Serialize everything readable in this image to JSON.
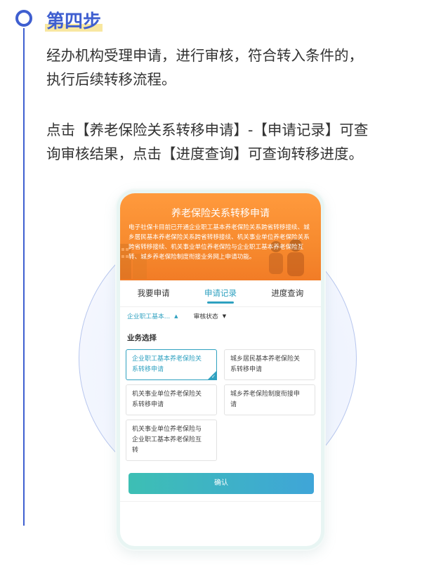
{
  "step": {
    "title": "第四步",
    "paragraph1_line1": "经办机构受理申请，进行审核，符合转入条件的，",
    "paragraph1_line2": "执行后续转移流程。",
    "paragraph2_line1": "点击【养老保险关系转移申请】-【申请记录】可查",
    "paragraph2_line2": "询审核结果，点击【进度查询】可查询转移进度。"
  },
  "phone": {
    "banner_title": "养老保险关系转移申请",
    "banner_desc": "电子社保卡目前已开通企业职工基本养老保险关系跨省转移接续、城乡居民基本养老保险关系跨省转移接续、机关事业单位养老保险关系跨省转移接续、机关事业单位养老保险与企业职工基本养老保险互转、城乡养老保险制度衔接业务网上申请功能。",
    "tabs": [
      {
        "label": "我要申请"
      },
      {
        "label": "申请记录"
      },
      {
        "label": "进度查询"
      }
    ],
    "filters": {
      "type": "企业职工基本...",
      "status": "审核状态"
    },
    "section_label": "业务选择",
    "options": [
      {
        "label": "企业职工基本养老保险关系转移申请",
        "line1": "企业职工基本养老保险关",
        "line2": "系转移申请"
      },
      {
        "label": "城乡居民基本养老保险关系转移申请",
        "line1": "城乡居民基本养老保险关",
        "line2": "系转移申请"
      },
      {
        "label": "机关事业单位养老保险关系转移申请",
        "line1": "机关事业单位养老保险关",
        "line2": "系转移申请"
      },
      {
        "label": "城乡养老保险制度衔接申请",
        "line1": "城乡养老保险制度衔接申",
        "line2": "请"
      },
      {
        "label": "机关事业单位养老保险与企业职工基本养老保险互转",
        "line1": "机关事业单位养老保险与",
        "line2": "企业职工基本养老保险互",
        "line3": "转"
      }
    ],
    "confirm_label": "确认"
  },
  "colors": {
    "accent_blue": "#3f5fd0",
    "banner_orange": "#f78a2e",
    "teal": "#2fa1c0"
  },
  "icons": {
    "step_marker": "circle-outline-icon",
    "dropdown": "caret-icon",
    "selected_check": "checkmark-icon"
  }
}
